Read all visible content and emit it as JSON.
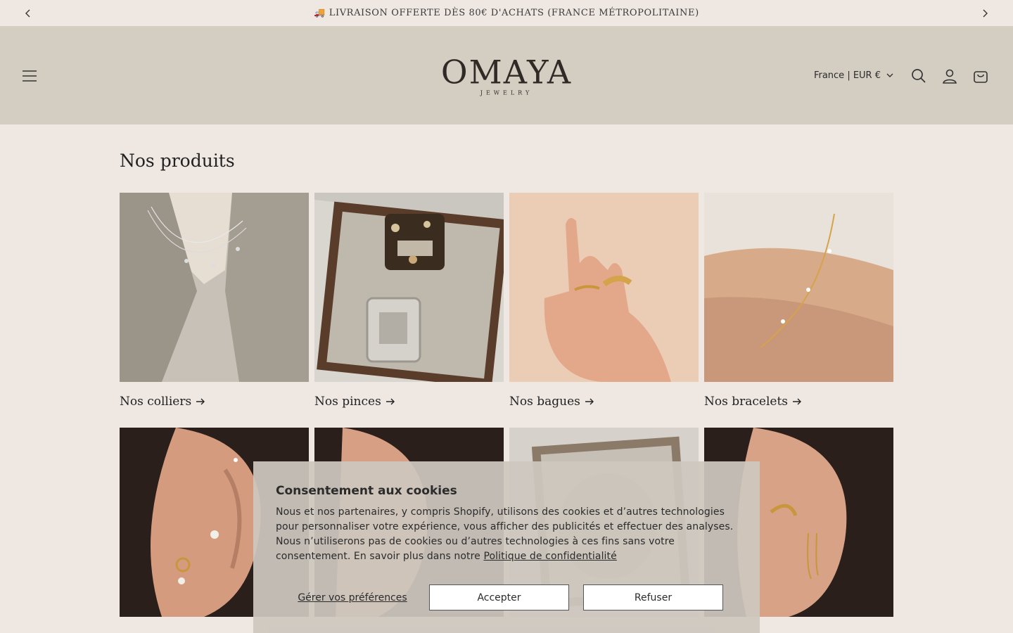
{
  "announcement": {
    "text": "🚚 LIVRAISON OFFERTE DÈS 80€ D'ACHATS (FRANCE MÉTROPOLITAINE)"
  },
  "header": {
    "logo_main": "OMAYA",
    "logo_sub": "JEWELRY",
    "locale": "France | EUR €"
  },
  "main": {
    "title": "Nos produits",
    "products": [
      {
        "label": "Nos colliers"
      },
      {
        "label": "Nos pinces"
      },
      {
        "label": "Nos bagues"
      },
      {
        "label": "Nos bracelets"
      },
      {
        "label": ""
      },
      {
        "label": ""
      },
      {
        "label": ""
      },
      {
        "label": ""
      }
    ]
  },
  "cookie": {
    "title": "Consentement aux cookies",
    "body": "Nous et nos partenaires, y compris Shopify, utilisons des cookies et d’autres technologies pour personnaliser votre expérience, vous afficher des publicités et effectuer des analyses. Nous n’utiliserons pas de cookies ou d’autres technologies à ces fins sans votre consentement. En savoir plus dans notre ",
    "link": "Politique de confidentialité",
    "manage": "Gérer vos préférences",
    "accept": "Accepter",
    "refuse": "Refuser"
  }
}
